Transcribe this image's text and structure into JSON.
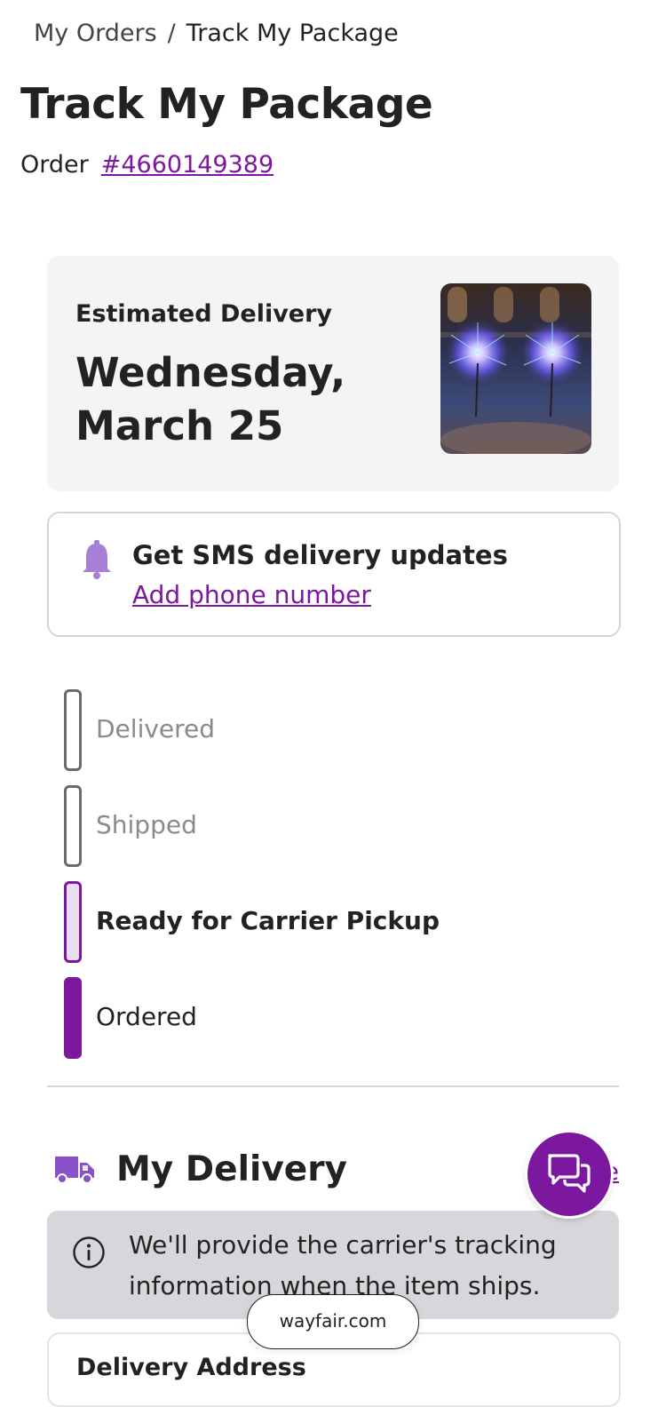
{
  "breadcrumb": {
    "parent": "My Orders",
    "separator": "/",
    "current": "Track My Package"
  },
  "page": {
    "title": "Track My Package",
    "order_label": "Order",
    "order_number": "#4660149389"
  },
  "delivery": {
    "label": "Estimated Delivery",
    "date": "Wednesday, March 25"
  },
  "sms": {
    "title": "Get SMS delivery updates",
    "link": "Add phone number",
    "icon": "bell-icon"
  },
  "timeline": {
    "steps": [
      {
        "label": "Delivered",
        "state": "pending"
      },
      {
        "label": "Shipped",
        "state": "pending"
      },
      {
        "label": "Ready for Carrier Pickup",
        "state": "current"
      },
      {
        "label": "Ordered",
        "state": "complete"
      }
    ]
  },
  "my_delivery": {
    "title": "My Delivery",
    "link_fragment": "e",
    "icon": "truck-icon"
  },
  "info_banner": {
    "message": "We'll provide the carrier's tracking information when the item ships.",
    "icon": "info-icon"
  },
  "address": {
    "title": "Delivery Address"
  },
  "browser": {
    "url": "wayfair.com"
  },
  "chat": {
    "icon": "chat-icon"
  },
  "colors": {
    "accent": "#7b189f",
    "accent_light": "#e7dff0",
    "card_bg": "#f4f4f4",
    "banner_bg": "#d7d7db"
  }
}
